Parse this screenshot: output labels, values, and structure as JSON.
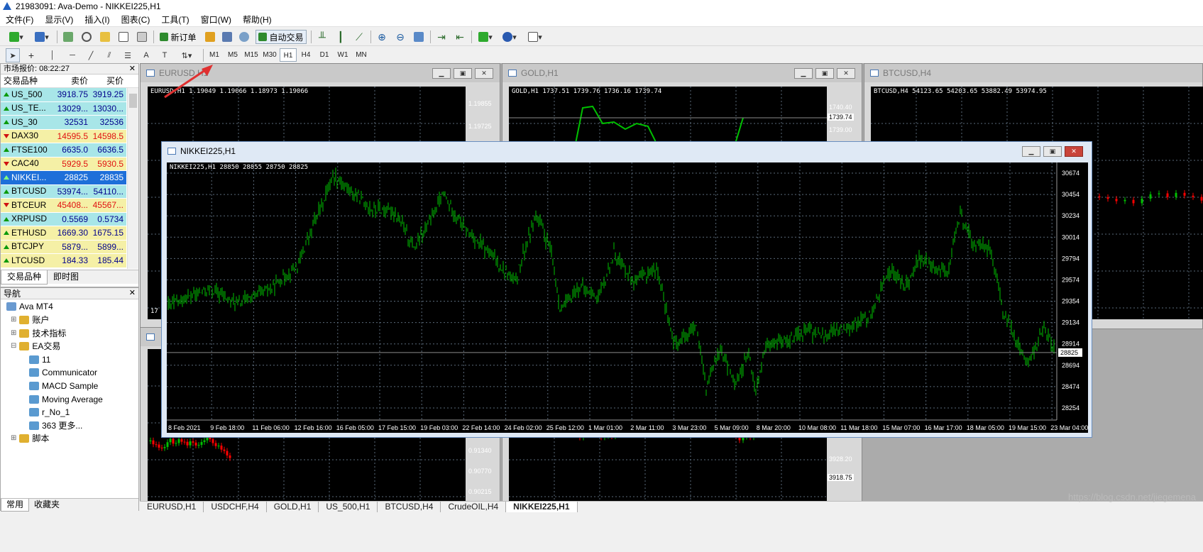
{
  "app": {
    "title": "21983091: Ava-Demo - NIKKEI225,H1"
  },
  "menu": [
    "文件(F)",
    "显示(V)",
    "插入(I)",
    "图表(C)",
    "工具(T)",
    "窗口(W)",
    "帮助(H)"
  ],
  "toolbar": {
    "new_order": "新订单",
    "auto_trading": "自动交易"
  },
  "timeframes": [
    "M1",
    "M5",
    "M15",
    "M30",
    "H1",
    "H4",
    "D1",
    "W1",
    "MN"
  ],
  "active_timeframe": "H1",
  "market_watch": {
    "title": "市场报价: 08:22:27",
    "col_symbol": "交易品种",
    "col_bid": "卖价",
    "col_ask": "买价",
    "rows": [
      {
        "symbol": "US_500",
        "bid": "3918.75",
        "ask": "3919.25",
        "dir": "up",
        "bg": "#a8e6e8",
        "color": "#00008b"
      },
      {
        "symbol": "US_TE...",
        "bid": "13029...",
        "ask": "13030...",
        "dir": "up",
        "bg": "#a8e6e8",
        "color": "#00008b"
      },
      {
        "symbol": "US_30",
        "bid": "32531",
        "ask": "32536",
        "dir": "up",
        "bg": "#a8e6e8",
        "color": "#00008b"
      },
      {
        "symbol": "DAX30",
        "bid": "14595.5",
        "ask": "14598.5",
        "dir": "down",
        "bg": "#f5f0a6",
        "color": "#e01010"
      },
      {
        "symbol": "FTSE100",
        "bid": "6635.0",
        "ask": "6636.5",
        "dir": "up",
        "bg": "#a8e6e8",
        "color": "#00008b"
      },
      {
        "symbol": "CAC40",
        "bid": "5929.5",
        "ask": "5930.5",
        "dir": "down",
        "bg": "#f5f0a6",
        "color": "#e01010"
      },
      {
        "symbol": "NIKKEI...",
        "bid": "28825",
        "ask": "28835",
        "dir": "up",
        "bg": "#1e6fd9",
        "color": "#ffffff"
      },
      {
        "symbol": "BTCUSD",
        "bid": "53974...",
        "ask": "54110...",
        "dir": "up",
        "bg": "#a8e6e8",
        "color": "#00008b"
      },
      {
        "symbol": "BTCEUR",
        "bid": "45408...",
        "ask": "45567...",
        "dir": "down",
        "bg": "#f5f0a6",
        "color": "#e01010"
      },
      {
        "symbol": "XRPUSD",
        "bid": "0.5569",
        "ask": "0.5734",
        "dir": "up",
        "bg": "#a8e6e8",
        "color": "#00008b"
      },
      {
        "symbol": "ETHUSD",
        "bid": "1669.30",
        "ask": "1675.15",
        "dir": "up",
        "bg": "#f5f0a6",
        "color": "#00008b"
      },
      {
        "symbol": "BTCJPY",
        "bid": "5879...",
        "ask": "5899...",
        "dir": "up",
        "bg": "#f5f0a6",
        "color": "#00008b"
      },
      {
        "symbol": "LTCUSD",
        "bid": "184.33",
        "ask": "185.44",
        "dir": "up",
        "bg": "#f5f0a6",
        "color": "#00008b"
      }
    ],
    "tabs": [
      "交易品种",
      "即时图"
    ]
  },
  "navigator": {
    "title": "导航",
    "root": "Ava MT4",
    "items": [
      {
        "label": "账户",
        "level": 1
      },
      {
        "label": "技术指标",
        "level": 1
      },
      {
        "label": "EA交易",
        "level": 1
      },
      {
        "label": "11",
        "level": 2
      },
      {
        "label": "Communicator",
        "level": 2
      },
      {
        "label": "MACD Sample",
        "level": 2
      },
      {
        "label": "Moving Average",
        "level": 2
      },
      {
        "label": "r_No_1",
        "level": 2
      },
      {
        "label": "363 更多...",
        "level": 2
      },
      {
        "label": "脚本",
        "level": 1
      }
    ],
    "tabs": [
      "常用",
      "收藏夹"
    ]
  },
  "charts": {
    "eurusd": {
      "title": "EURUSD,H1",
      "info": "EURUSD,H1  1.19049 1.19066 1.18973 1.19066",
      "prices": [
        "1.19855",
        "1.19725"
      ],
      "low_prices": [
        "0.91340",
        "0.90770",
        "0.90215"
      ],
      "date_label": "17 N"
    },
    "gold": {
      "title": "GOLD,H1",
      "info": "GOLD,H1  1737.51 1739.76 1736.16 1739.74",
      "prices": [
        "1740.40",
        "1739.74",
        "1739.00"
      ],
      "low_prices": [
        "3928.20",
        "3918.75"
      ]
    },
    "btcusd": {
      "title": "BTCUSD,H4",
      "info": "BTCUSD,H4  54123.65 54203.65 53882.49 53974.95"
    },
    "nikkei": {
      "title": "NIKKEI225,H1",
      "info": "NIKKEI225,H1  28850 28855 28750 28825",
      "current": "28825",
      "prices": [
        "30674",
        "30454",
        "30234",
        "30014",
        "29794",
        "29574",
        "29354",
        "29134",
        "28914",
        "28694",
        "28474",
        "28254"
      ],
      "dates": [
        "8 Feb 2021",
        "9 Feb 18:00",
        "11 Feb 06:00",
        "12 Feb 16:00",
        "16 Feb 05:00",
        "17 Feb 15:00",
        "19 Feb 03:00",
        "22 Feb 14:00",
        "24 Feb 02:00",
        "25 Feb 12:00",
        "1 Mar 01:00",
        "2 Mar 11:00",
        "3 Mar 23:00",
        "5 Mar 09:00",
        "8 Mar 20:00",
        "10 Mar 08:00",
        "11 Mar 18:00",
        "15 Mar 07:00",
        "16 Mar 17:00",
        "18 Mar 05:00",
        "19 Mar 15:00",
        "23 Mar 04:00"
      ]
    }
  },
  "chart_tabs": [
    "EURUSD,H1",
    "USDCHF,H4",
    "GOLD,H1",
    "US_500,H1",
    "BTCUSD,H4",
    "CrudeOIL,H4",
    "NIKKEI225,H1"
  ],
  "active_chart_tab": "NIKKEI225,H1",
  "watermark": "https://blog.csdn.net/jiegemena",
  "colors": {
    "bull": "#00c000",
    "bear": "#ff0000",
    "chart_bg": "#000000",
    "grid": "#5a6a7a"
  }
}
